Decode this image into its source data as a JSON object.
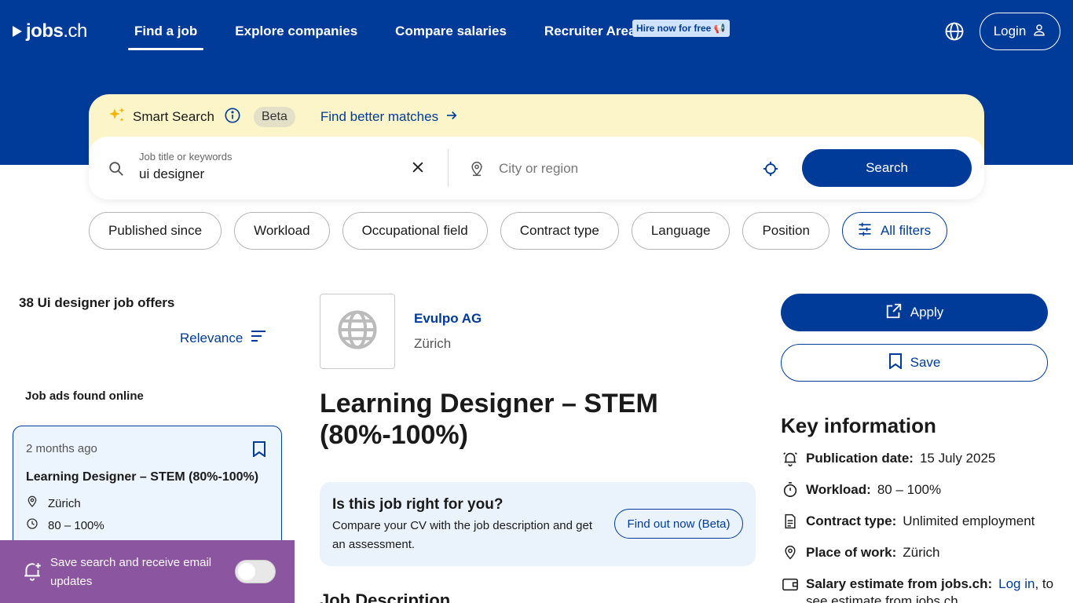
{
  "header": {
    "logo_main": "jobs",
    "logo_suffix": ".ch",
    "nav": [
      {
        "label": "Find a job"
      },
      {
        "label": "Explore companies"
      },
      {
        "label": "Compare salaries"
      },
      {
        "label": "Recruiter Area"
      }
    ],
    "hire_badge": "Hire now for free 📢",
    "login_label": "Login"
  },
  "search": {
    "smart_label": "Smart Search",
    "beta_label": "Beta",
    "find_better": "Find better matches",
    "keyword_label": "Job title or keywords",
    "keyword_value": "ui designer",
    "city_placeholder": "City or region",
    "search_button": "Search"
  },
  "filters": [
    "Published since",
    "Workload",
    "Occupational field",
    "Contract type",
    "Language",
    "Position",
    "All filters"
  ],
  "results": {
    "count_text": "38 Ui designer job offers",
    "sort_label": "Relevance",
    "section_label": "Job ads found online",
    "card": {
      "posted": "2 months ago",
      "title": "Learning Designer – STEM (80%-100%)",
      "location": "Zürich",
      "workload": "80 – 100%"
    }
  },
  "toast": {
    "text": "Save search and receive email updates",
    "toggle_on": false
  },
  "detail": {
    "company": "Evulpo AG",
    "city": "Zürich",
    "title": "Learning Designer – STEM (80%-100%)",
    "fit_heading": "Is this job right for you?",
    "fit_text": "Compare your CV with the job description and get an assessment.",
    "fit_button": "Find out now (Beta)",
    "description_heading": "Job Description"
  },
  "sidebar": {
    "apply_label": "Apply",
    "save_label": "Save",
    "key_heading": "Key information",
    "items": [
      {
        "label": "Publication date:",
        "value": "15 July 2025",
        "icon": "bell-icon"
      },
      {
        "label": "Workload:",
        "value": "80 – 100%",
        "icon": "stopwatch-icon"
      },
      {
        "label": "Contract type:",
        "value": "Unlimited employment",
        "icon": "document-icon"
      },
      {
        "label": "Place of work:",
        "value": "Zürich",
        "icon": "pin-icon"
      },
      {
        "label": "Salary estimate from jobs.ch:",
        "value": "",
        "link": "Log in",
        "suffix": ", to",
        "icon": "wallet-icon"
      }
    ],
    "salary_more": "see estimate from jobs.ch"
  },
  "colors": {
    "brand": "#003b99",
    "smart_bg": "#fbf5c9",
    "card_bg": "#ecf4fd",
    "toast_bg": "#8c55a0"
  }
}
